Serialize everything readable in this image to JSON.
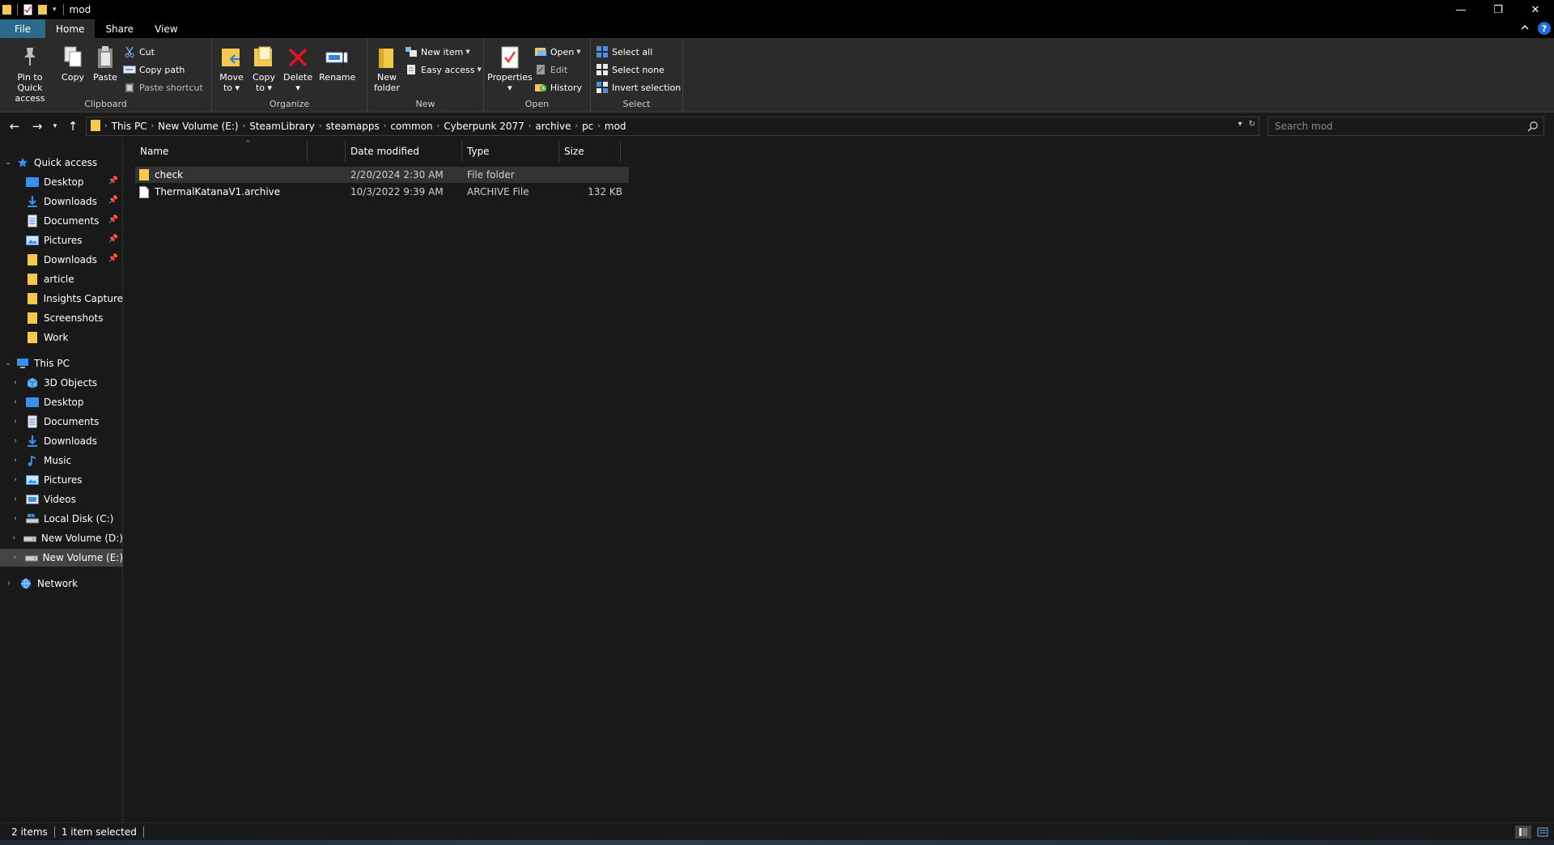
{
  "window": {
    "title": "mod",
    "controls": {
      "minimize": "—",
      "restore": "❐",
      "close": "✕"
    }
  },
  "tabs": [
    {
      "label": "File"
    },
    {
      "label": "Home"
    },
    {
      "label": "Share"
    },
    {
      "label": "View"
    }
  ],
  "help_label": "?",
  "ribbon": {
    "clipboard": {
      "label": "Clipboard",
      "pin": "Pin to Quick\naccess",
      "copy": "Copy",
      "paste": "Paste",
      "cut": "Cut",
      "copy_path": "Copy path",
      "paste_shortcut": "Paste shortcut"
    },
    "organize": {
      "label": "Organize",
      "move_to": "Move\nto ▾",
      "copy_to": "Copy\nto ▾",
      "delete": "Delete\n▾",
      "rename": "Rename"
    },
    "new": {
      "label": "New",
      "new_folder": "New\nfolder",
      "new_item": "New item",
      "easy_access": "Easy access"
    },
    "open": {
      "label": "Open",
      "properties": "Properties\n▾",
      "open": "Open",
      "edit": "Edit",
      "history": "History"
    },
    "select": {
      "label": "Select",
      "select_all": "Select all",
      "select_none": "Select none",
      "invert_selection": "Invert selection"
    }
  },
  "address": {
    "crumbs": [
      "This PC",
      "New Volume (E:)",
      "SteamLibrary",
      "steamapps",
      "common",
      "Cyberpunk 2077",
      "archive",
      "pc",
      "mod"
    ]
  },
  "search": {
    "placeholder": "Search mod"
  },
  "nav": {
    "quick_access": "Quick access",
    "quick_items": [
      "Desktop",
      "Downloads",
      "Documents",
      "Pictures",
      "Downloads",
      "article",
      "Insights Capture",
      "Screenshots",
      "Work"
    ],
    "this_pc": "This PC",
    "pc_items": [
      "3D Objects",
      "Desktop",
      "Documents",
      "Downloads",
      "Music",
      "Pictures",
      "Videos",
      "Local Disk (C:)",
      "New Volume (D:)",
      "New Volume (E:)"
    ],
    "network": "Network"
  },
  "columns": {
    "name": "Name",
    "date": "Date modified",
    "type": "Type",
    "size": "Size"
  },
  "files": [
    {
      "name": "check",
      "date": "2/20/2024 2:30 AM",
      "type": "File folder",
      "size": ""
    },
    {
      "name": "ThermalKatanaV1.archive",
      "date": "10/3/2022 9:39 AM",
      "type": "ARCHIVE File",
      "size": "132 KB"
    }
  ],
  "status": {
    "items": "2 items",
    "selected": "1 item selected"
  },
  "colors": {
    "accent": "#2b6a8a",
    "folder": "#f4c94e",
    "background": "#191919",
    "ribbon": "#2b2b2b"
  }
}
